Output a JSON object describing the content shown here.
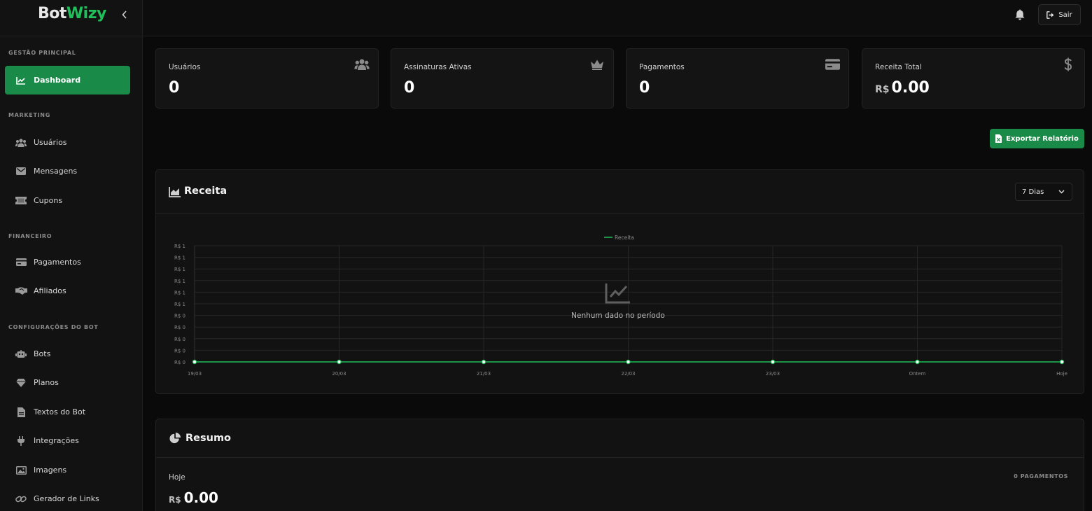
{
  "brand": {
    "part1": "Bot",
    "part2": "Wizy"
  },
  "sidebar": {
    "sections": [
      {
        "title": "GESTÃO PRINCIPAL"
      },
      {
        "title": "MARKETING"
      },
      {
        "title": "FINANCEIRO"
      },
      {
        "title": "CONFIGURAÇÕES DO BOT"
      }
    ],
    "items": [
      {
        "label": "Dashboard",
        "icon": "chart-line-icon",
        "active": true
      },
      {
        "label": "Usuários",
        "icon": "users-icon"
      },
      {
        "label": "Mensagens",
        "icon": "envelope-icon"
      },
      {
        "label": "Cupons",
        "icon": "ticket-icon"
      },
      {
        "label": "Pagamentos",
        "icon": "credit-card-icon"
      },
      {
        "label": "Afiliados",
        "icon": "handshake-icon"
      },
      {
        "label": "Bots",
        "icon": "robot-icon"
      },
      {
        "label": "Planos",
        "icon": "gem-icon"
      },
      {
        "label": "Textos do Bot",
        "icon": "file-text-icon"
      },
      {
        "label": "Integrações",
        "icon": "plug-icon"
      },
      {
        "label": "Imagens",
        "icon": "images-icon"
      },
      {
        "label": "Gerador de Links",
        "icon": "link-icon"
      }
    ]
  },
  "topbar": {
    "logout_label": "Sair"
  },
  "stats": [
    {
      "label": "Usuários",
      "value": "0",
      "icon": "users-icon"
    },
    {
      "label": "Assinaturas Ativas",
      "value": "0",
      "icon": "crown-icon"
    },
    {
      "label": "Pagamentos",
      "value": "0",
      "icon": "credit-card-icon"
    },
    {
      "label": "Receita Total",
      "currency": "R$",
      "value": "0.00",
      "icon": "dollar-icon"
    }
  ],
  "export_label": "Exportar Relatório",
  "revenue": {
    "title": "Receita",
    "period": "7 Dias",
    "empty_text": "Nenhum dado no período"
  },
  "chart_data": {
    "type": "line",
    "categories": [
      "19/03",
      "20/03",
      "21/03",
      "22/03",
      "23/03",
      "Ontem",
      "Hoje"
    ],
    "series": [
      {
        "name": "Receita",
        "values": [
          0,
          0,
          0,
          0,
          0,
          0,
          0
        ]
      }
    ],
    "y_ticks": [
      "R$ 1",
      "R$ 1",
      "R$ 1",
      "R$ 1",
      "R$ 1",
      "R$ 1",
      "R$ 0",
      "R$ 0",
      "R$ 0",
      "R$ 0",
      "R$ 0"
    ],
    "legend_position": "top-center",
    "grid": true,
    "line_color": "#1fbf5a"
  },
  "summary": {
    "title": "Resumo",
    "today_label": "Hoje",
    "payments_count": "0 PAGAMENTOS",
    "currency": "R$",
    "today_value": "0.00"
  },
  "colors": {
    "accent": "#1a8a49",
    "brand_green": "#1fbf5a",
    "background": "#0a0a0a",
    "panel": "#121212"
  }
}
